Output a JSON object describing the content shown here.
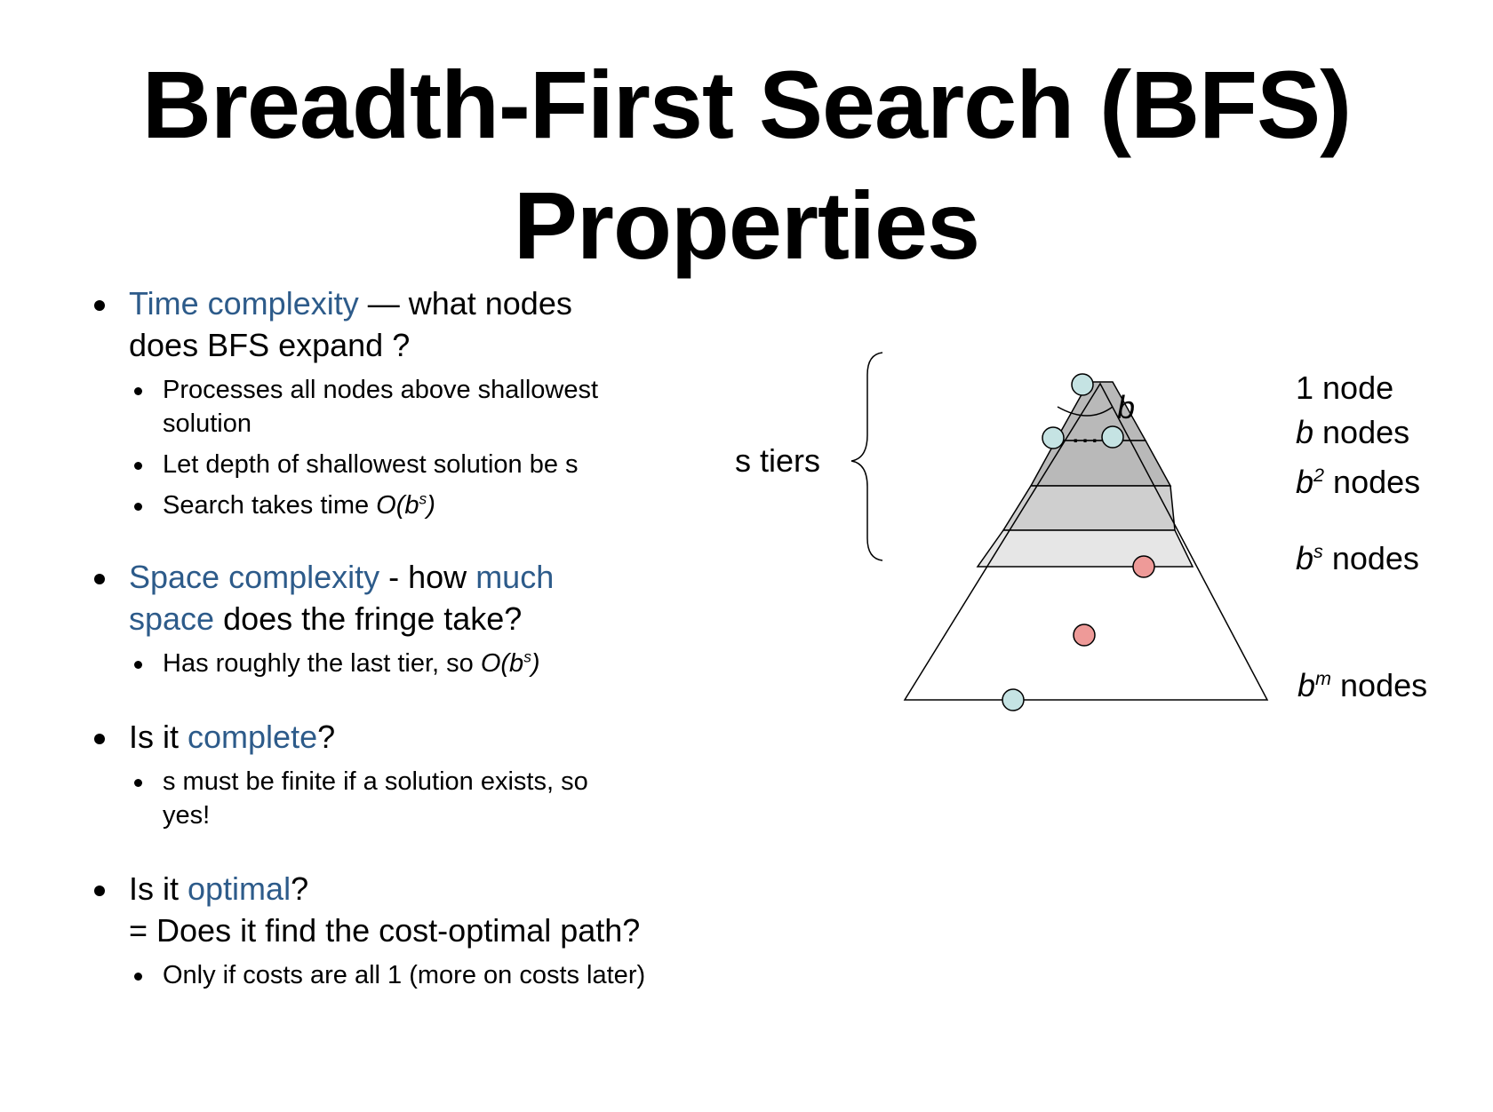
{
  "title": {
    "line1": "Breadth-First Search (BFS)",
    "line2": "Properties"
  },
  "bullets": {
    "time": {
      "term": "Time complexity",
      "rest1": " — what nodes",
      "rest2": "does BFS expand ?",
      "sub1_line1": "Processes all nodes above shallowest",
      "sub1_line2": "solution",
      "sub2": "Let depth of shallowest solution be s",
      "sub3_pre": "Search takes time ",
      "sub3_o": "O(b",
      "sub3_sup": "s",
      "sub3_close": ")"
    },
    "space": {
      "term": "Space complexity",
      "mid": " - how ",
      "much": "much",
      "space_word": "space",
      "rest": " does the fringe take?",
      "sub1_pre": "Has roughly the last tier, so ",
      "sub1_o": "O(b",
      "sub1_sup": "s",
      "sub1_close": ")"
    },
    "complete": {
      "pre": "Is it ",
      "term": "complete",
      "post": "?",
      "sub1_line1": "s must be finite if a solution exists, so",
      "sub1_line2": "yes!"
    },
    "optimal": {
      "pre": "Is it ",
      "term": "optimal",
      "post": "?",
      "line2": "= Does it find the cost-optimal path?",
      "sub1": "Only if costs are all 1 (more on costs later)"
    }
  },
  "diagram": {
    "tiers_label": "s tiers",
    "branch_label": "b",
    "dots": "…",
    "levels": [
      {
        "base": "1",
        "sup": "",
        "suffix": " node",
        "italic": false
      },
      {
        "base": "b",
        "sup": "",
        "suffix": " nodes",
        "italic": true
      },
      {
        "base": "b",
        "sup": "2",
        "suffix": " nodes",
        "italic": true
      },
      {
        "base": "b",
        "sup": "s",
        "suffix": " nodes",
        "italic": true
      },
      {
        "base": "b",
        "sup": "m",
        "suffix": " nodes",
        "italic": true
      }
    ],
    "colors": {
      "explored_node": "#c5e3e3",
      "solution_node": "#ee9a98",
      "tier_dark": "#b9b9b9",
      "tier_mid": "#cfcfcf",
      "tier_light": "#e6e6e6",
      "accent_text": "#2d5b8a"
    }
  }
}
